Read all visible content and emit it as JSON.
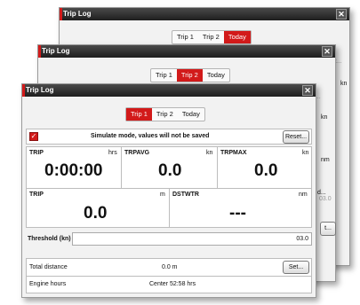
{
  "window": {
    "title": "Trip Log",
    "close_glyph": "✕"
  },
  "tabs": [
    "Trip 1",
    "Trip 2",
    "Today"
  ],
  "simulate": {
    "checked": true,
    "text": "Simulate mode, values will not be saved",
    "reset_label": "Reset..."
  },
  "trip": {
    "label": "TRIP",
    "unit": "hrs",
    "value": "0:00:00"
  },
  "trpavg": {
    "label": "TRPAVG",
    "unit": "kn",
    "value": "0.0"
  },
  "trpmax": {
    "label": "TRPMAX",
    "unit": "kn",
    "value": "0.0"
  },
  "trip_dist": {
    "label": "TRIP",
    "unit": "m",
    "value": "0.0"
  },
  "dstwtr": {
    "label": "DSTWTR",
    "unit": "nm",
    "value": "---"
  },
  "threshold": {
    "label": "Threshold (kn)",
    "value": "03.0"
  },
  "total_distance": {
    "label": "Total distance",
    "value": "0.0 m",
    "set_label": "Set..."
  },
  "engine_hours": {
    "label": "Engine hours",
    "value": "Center 52:58 hrs"
  },
  "ghost": {
    "reset_fragment": "et...",
    "kn": "kn",
    "nm": "nm",
    "val": "03.0",
    "d_fragment": "d...",
    "t_fragment": "t..."
  },
  "colors": {
    "accent": "#d21a1a",
    "titlebar": "#1e1e1e"
  },
  "icons": [
    "close-icon",
    "checkbox-icon"
  ]
}
